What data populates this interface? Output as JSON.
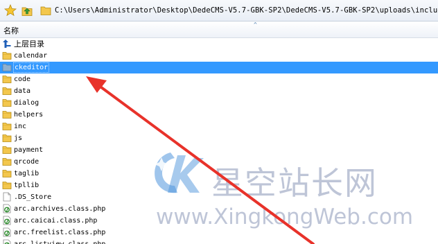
{
  "path_bar": {
    "path": "C:\\Users\\Administrator\\Desktop\\DedeCMS-V5.7-GBK-SP2\\DedeCMS-V5.7-GBK-SP2\\uploads\\include"
  },
  "list_header": {
    "name_label": "名称",
    "sort_indicator": "^"
  },
  "up_item": {
    "label": "上层目录"
  },
  "folders": [
    "calendar",
    "ckeditor",
    "code",
    "data",
    "dialog",
    "helpers",
    "inc",
    "js",
    "payment",
    "qrcode",
    "taglib",
    "tpllib"
  ],
  "selected": "ckeditor",
  "files": [
    {
      "label": ".DS_Store",
      "icon": "blank-file-icon"
    },
    {
      "label": "arc.archives.class.php",
      "icon": "php-file-icon"
    },
    {
      "label": "arc.caicai.class.php",
      "icon": "php-file-icon"
    },
    {
      "label": "arc.freelist.class.php",
      "icon": "php-file-icon"
    },
    {
      "label": "arc.listview.class.php",
      "icon": "php-file-icon"
    }
  ],
  "watermark": {
    "chinese": "星空站长网",
    "english": "www.XingkongWeb.com"
  },
  "colors": {
    "selection": "#3399ff",
    "arrow": "#e8322a",
    "folder": "#f3c74d"
  }
}
